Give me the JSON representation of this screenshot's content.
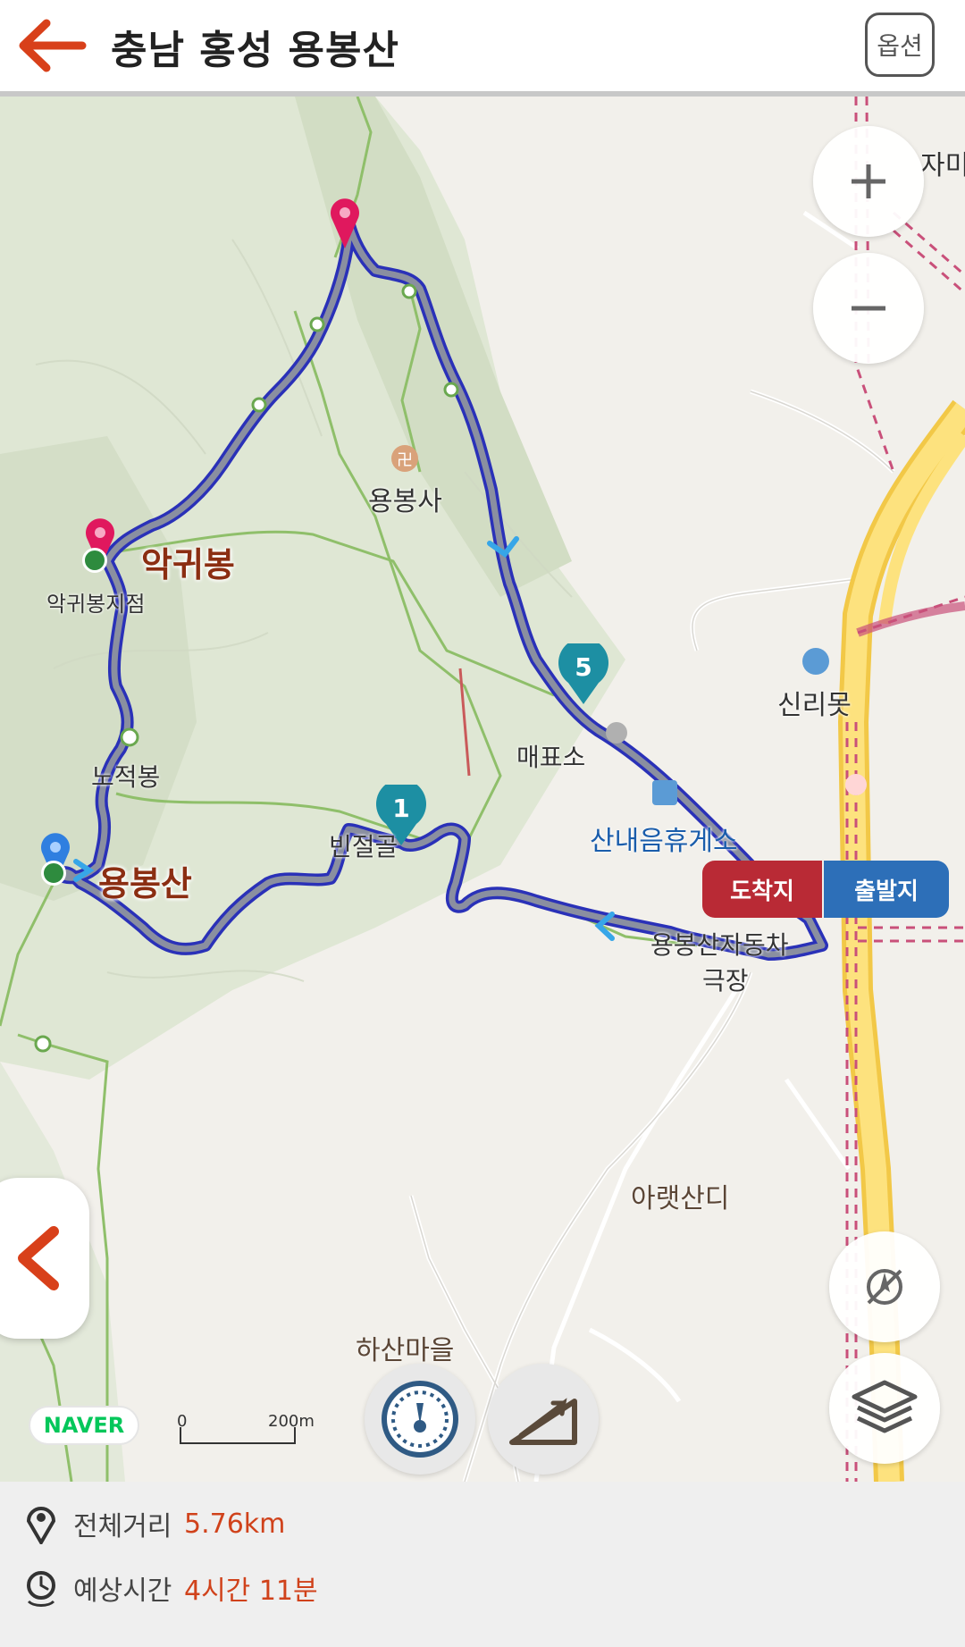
{
  "header": {
    "title": "충남 홍성 용봉산",
    "option_label": "옵션"
  },
  "map": {
    "labels": {
      "yongbongsa": "용봉사",
      "akgwibong": "악귀봉",
      "akgwibong_point": "악귀봉지점",
      "nojeokbong": "노적봉",
      "yongbongsan": "용봉산",
      "binjeol": "빈절골",
      "ticket_office": "매표소",
      "rest_area": "산내음휴게소",
      "parking": "용봉산자동차",
      "parking2": "극장",
      "sinrimot": "신리못",
      "araetsandi": "아랫산디",
      "hasanmaeul": "하산마을",
      "jami": "자미"
    },
    "markers": {
      "waypoint1": "1",
      "waypoint5": "5"
    },
    "flags": {
      "arrival": "도착지",
      "departure": "출발지"
    },
    "brand": "NAVER",
    "scale": {
      "zero": "0",
      "value": "200m"
    },
    "buttons": {
      "zoom_in": "zoom-in",
      "zoom_out": "zoom-out",
      "compass": "compass-off",
      "layers": "layers",
      "speedometer": "speedometer",
      "elevation": "elevation"
    }
  },
  "info": {
    "distance_label": "전체거리",
    "distance_value": "5.76km",
    "time_label": "예상시간",
    "time_value": "4시간 11분"
  },
  "colors": {
    "accent": "#d0421b",
    "route": "#2a31b8",
    "header_bg": "#ffffff"
  }
}
